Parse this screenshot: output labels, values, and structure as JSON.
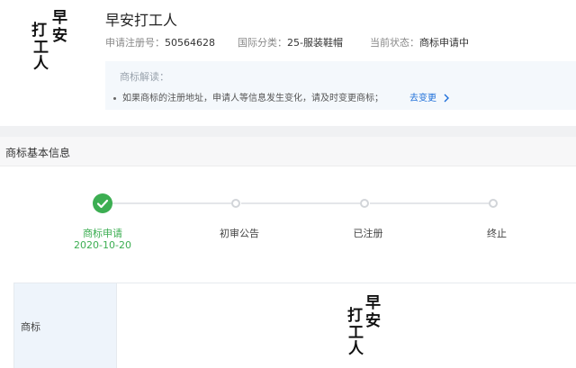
{
  "header": {
    "logo_chars": [
      "早",
      "安",
      "打",
      "工",
      "人"
    ],
    "title": "早安打工人",
    "reg_label": "申请注册号：",
    "reg_value": "50564628",
    "class_label": "国际分类：",
    "class_value": "25-服装鞋帽",
    "status_label": "当前状态：",
    "status_value": "商标申请中"
  },
  "notice": {
    "title": "商标解读：",
    "text": "如果商标的注册地址，申请人等信息发生变化，请及时变更商标；",
    "link": "去变更",
    "link_icon": "chevron-right-icon"
  },
  "section": {
    "title": "商标基本信息"
  },
  "timeline": {
    "steps": [
      {
        "label": "商标申请",
        "date": "2020-10-20",
        "done": true
      },
      {
        "label": "初审公告",
        "date": "",
        "done": false
      },
      {
        "label": "已注册",
        "date": "",
        "done": false
      },
      {
        "label": "终止",
        "date": "",
        "done": false
      }
    ],
    "done_color": "#3cae52",
    "done_icon": "check-icon"
  },
  "info_table": {
    "key": "商标"
  },
  "colors": {
    "accent": "#1e6fd9",
    "success": "#3cae52"
  }
}
